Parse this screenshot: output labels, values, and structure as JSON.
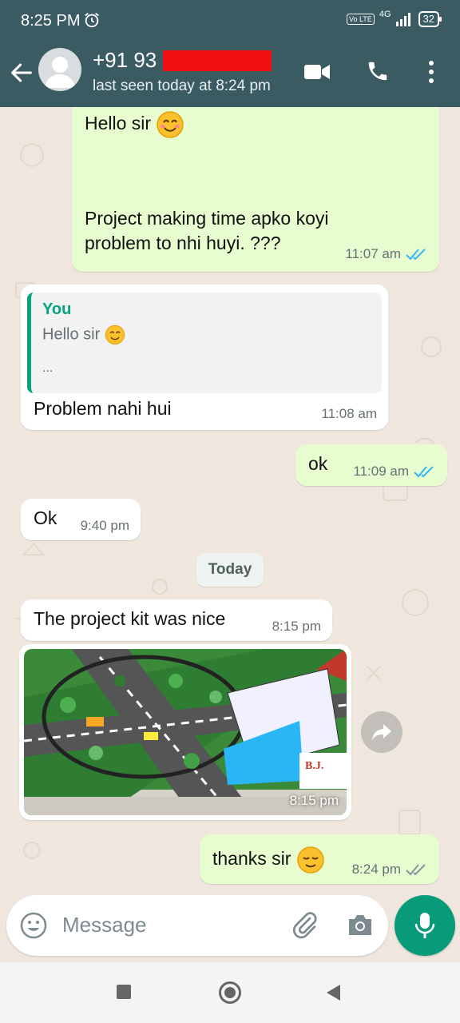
{
  "status_bar": {
    "time": "8:25 PM",
    "volte": "Vo LTE",
    "network": "4G",
    "battery": "32"
  },
  "header": {
    "contact_name": "+91 93",
    "last_seen": "last seen today at 8:24 pm"
  },
  "messages": {
    "m1": {
      "line1": "Hello sir",
      "line2": "Project making time apko koyi",
      "line3": "problem to nhi huyi.  ???",
      "time": "11:07 am"
    },
    "m2": {
      "quote_author": "You",
      "quote_text": "Hello sir",
      "quote_more": "...",
      "text": "Problem nahi hui",
      "time": "11:08 am"
    },
    "m3": {
      "text": "ok",
      "time": "11:09 am"
    },
    "m4": {
      "text": "Ok",
      "time": "9:40 pm"
    },
    "date_chip": "Today",
    "m5": {
      "text": "The project kit was nice",
      "time": "8:15 pm"
    },
    "m6": {
      "time": "8:15 pm"
    },
    "m7": {
      "text": "thanks sir",
      "time": "8:24 pm"
    }
  },
  "composer": {
    "placeholder": "Message"
  },
  "colors": {
    "header_bg": "#3b5b63",
    "outgoing_bubble": "#e7fccf",
    "incoming_bubble": "#ffffff",
    "accent": "#079b7a",
    "read_ticks": "#34b7f1"
  }
}
